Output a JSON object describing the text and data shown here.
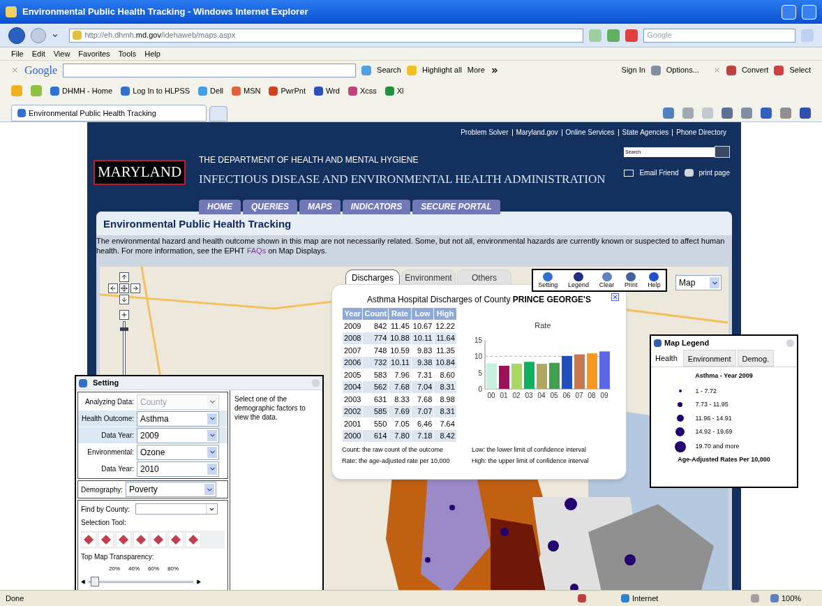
{
  "window": {
    "title": "Environmental Public Health Tracking - Windows Internet Explorer"
  },
  "address_bar": {
    "url_prefix": "http://eh.dhmh.",
    "url_domain": "md.gov",
    "url_path": "/idehaweb/maps.aspx",
    "search_placeholder": "Google"
  },
  "menu": [
    "File",
    "Edit",
    "View",
    "Favorites",
    "Tools",
    "Help"
  ],
  "google_toolbar": {
    "logo": "Google",
    "search": "Search",
    "highlight": "Highlight all",
    "more": "More",
    "sign_in": "Sign In",
    "options": "Options...",
    "convert": "Convert",
    "select": "Select"
  },
  "favorites": [
    "DHMH - Home",
    "Log In to HLPSS",
    "Dell",
    "MSN",
    "PwrPnt",
    "Wrd",
    "Xcss",
    "Xl"
  ],
  "tabs": [
    {
      "label": "Environmental Public Health Tracking",
      "selected": true
    }
  ],
  "site": {
    "top_links": [
      "Problem Solver",
      "Maryland.gov",
      "Online Services",
      "State Agencies",
      "Phone Directory"
    ],
    "logo": "MARYLAND",
    "search_placeholder": "Search",
    "department": "THE DEPARTMENT OF HEALTH AND MENTAL HYGIENE",
    "administration": "INFECTIOUS DISEASE AND ENVIRONMENTAL HEALTH ADMINISTRATION",
    "email": "Email Friend",
    "print": "print page",
    "nav": [
      {
        "label": "HOME",
        "selected": false
      },
      {
        "label": "QUERIES",
        "selected": false
      },
      {
        "label": "MAPS",
        "selected": false
      },
      {
        "label": "INDICATORS",
        "selected": false
      },
      {
        "label": "SECURE PORTAL",
        "selected": false
      }
    ]
  },
  "page": {
    "title": "Environmental Public Health Tracking",
    "intro": "The environmental hazard and health outcome shown in this map are not necessarily related. Some, but not all, environmental hazards are currently known or suspected to affect human health. For more information, see the EPHT ",
    "link": "FAQs",
    "intro_end": " on Map Displays."
  },
  "map": {
    "view_select": "Map",
    "zoom": {
      "level": 0.9
    },
    "toolbar": [
      "Setting",
      "Legend",
      "Clear",
      "Print",
      "Help"
    ],
    "popup": {
      "tabs": [
        {
          "label": "Discharges",
          "selected": true
        },
        {
          "label": "Environment",
          "selected": false
        },
        {
          "label": "Others",
          "selected": false
        }
      ],
      "title": "Asthma Hospital Discharges of County **PRINCE GEORGE'S**",
      "columns": [
        "Year",
        "Count",
        "Rate",
        "Low",
        "High"
      ],
      "rows": [
        [
          "2009",
          "842",
          "11.45",
          "10.67",
          "12.22"
        ],
        [
          "2008",
          "774",
          "10.88",
          "10.11",
          "11.64"
        ],
        [
          "2007",
          "748",
          "10.59",
          "9.83",
          "11.35"
        ],
        [
          "2006",
          "732",
          "10.11",
          "9.38",
          "10.84"
        ],
        [
          "2005",
          "583",
          "7.96",
          "7.31",
          "8.60"
        ],
        [
          "2004",
          "562",
          "7.68",
          "7.04",
          "8.31"
        ],
        [
          "2003",
          "631",
          "8.33",
          "7.68",
          "8.98"
        ],
        [
          "2002",
          "585",
          "7.69",
          "7.07",
          "8.31"
        ],
        [
          "2001",
          "550",
          "7.05",
          "6.46",
          "7.64"
        ],
        [
          "2000",
          "614",
          "7.80",
          "7.18",
          "8.42"
        ]
      ],
      "chart_data": {
        "type": "bar",
        "title": "Rate",
        "categories": [
          "00",
          "01",
          "02",
          "03",
          "04",
          "05",
          "06",
          "07",
          "08",
          "09"
        ],
        "series": [
          {
            "colors": [
              "#c8f0e0",
              "#a0105a",
              "#a8d860",
              "#10b060",
              "#b0a860",
              "#40a050",
              "#2050c0",
              "#c87850",
              "#f89820",
              "#5b67e8"
            ],
            "values": [
              7.8,
              7.1,
              7.7,
              8.3,
              7.7,
              8.0,
              10.1,
              10.6,
              10.9,
              11.5
            ]
          }
        ],
        "ylim": [
          0,
          15
        ],
        "yticks": [
          0,
          5,
          10,
          15
        ]
      },
      "notes": [
        "Count: the raw count of the outcome",
        "Low: the lower limit of confidence interval",
        "Rate: the age-adjusted rate per 10,000",
        "High: the upper limit of confidence interval"
      ]
    },
    "legend": {
      "title": "Map Legend",
      "tabs": [
        {
          "label": "Health",
          "selected": true
        },
        {
          "label": "Environment",
          "selected": false
        },
        {
          "label": "Demog.",
          "selected": false
        }
      ],
      "heading": "Asthma - Year 2009",
      "classes": [
        "1 - 7.72",
        "7.73 - 11.95",
        "11.96 - 14.91",
        "14.92 - 19.69",
        "19.70 and more"
      ],
      "footer": "Age-Adjusted Rates Per 10,000"
    },
    "setting": {
      "title": "Setting",
      "fields": [
        {
          "label": "Analyzing Data:",
          "value": "County",
          "disabled": true,
          "highlighted": false
        },
        {
          "label": "Health Outcome:",
          "value": "Asthma",
          "disabled": false,
          "highlighted": true
        },
        {
          "label": "Data Year:",
          "value": "2009",
          "disabled": false,
          "highlighted": true
        },
        {
          "label": "Environmental:",
          "value": "Ozone",
          "disabled": false,
          "highlighted": false
        },
        {
          "label": "Data Year:",
          "value": "2010",
          "disabled": false,
          "highlighted": false
        }
      ],
      "demography": {
        "label": "Demography:",
        "value": "Poverty"
      },
      "help": "Select one of the demographic factors to view the data.",
      "find_label": "Find by County:",
      "selection_label": "Selection Tool:",
      "transparency_label": "Top Map Transparency:",
      "ticks": [
        "20%",
        "40%",
        "60%",
        "80%"
      ],
      "transparency": {
        "level": 0.02
      }
    }
  },
  "status_bar": {
    "text": "Done",
    "zone": "Internet",
    "zoom": "100%"
  }
}
